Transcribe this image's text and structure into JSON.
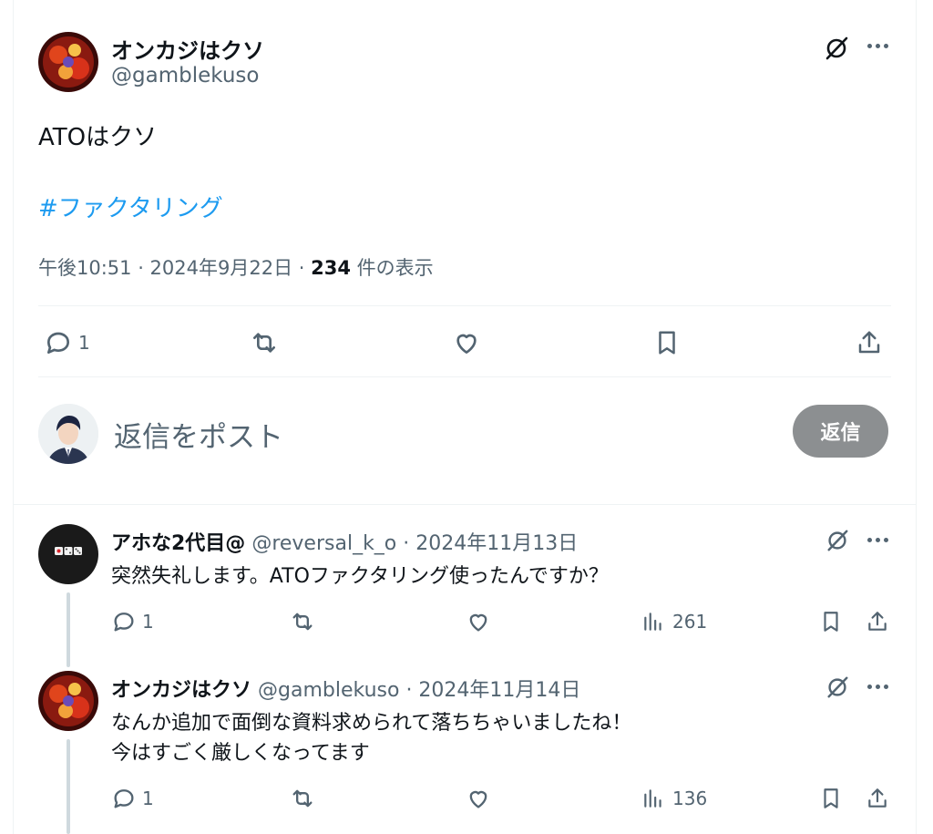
{
  "main_tweet": {
    "display_name": "オンカジはクソ",
    "handle": "@gamblekuso",
    "text": "ATOはクソ",
    "hashtag": "#ファクタリング",
    "timestamp": "午後10:51 · 2024年9月22日 · ",
    "views_count": "234",
    "views_label": " 件の表示",
    "reply_count": "1"
  },
  "composer": {
    "placeholder": "返信をポスト",
    "reply_button": "返信"
  },
  "replies": [
    {
      "display_name": "アホな2代目@",
      "handle": "@reversal_k_o",
      "date": "· 2024年11月13日",
      "text_lines": [
        "突然失礼します。ATOファクタリング使ったんですか？"
      ],
      "reply_count": "1",
      "views": "261"
    },
    {
      "display_name": "オンカジはクソ",
      "handle": "@gamblekuso",
      "date": "· 2024年11月14日",
      "text_lines": [
        "なんか追加で面倒な資料求められて落ちちゃいましたね！",
        "今はすごく厳しくなってます"
      ],
      "reply_count": "1",
      "views": "136"
    }
  ],
  "colors": {
    "link": "#1d9bf0",
    "muted": "#536471",
    "reply_button_bg": "#8c8f91"
  },
  "icons": [
    "grok-icon",
    "more-icon",
    "reply-icon",
    "retweet-icon",
    "like-icon",
    "bookmark-icon",
    "share-icon",
    "views-icon"
  ]
}
